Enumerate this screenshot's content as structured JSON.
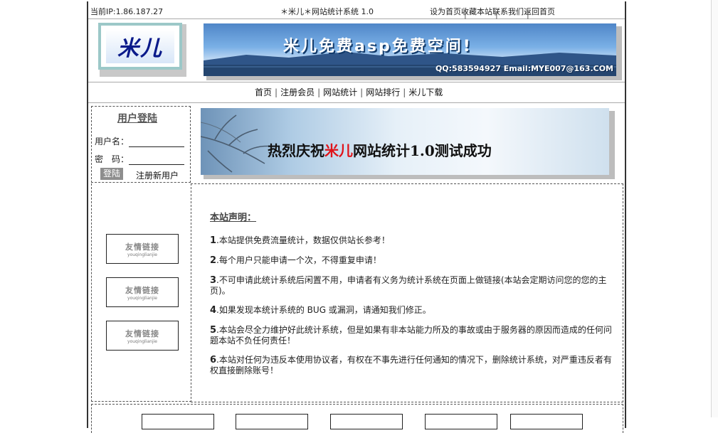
{
  "topbar": {
    "ip": "当前IP:1.86.187.27",
    "site_title": "＊米儿＊网站统计系统 1.0",
    "links": [
      "设为首页",
      "收藏本站",
      "联系我们",
      "返回首页"
    ],
    "separator": "|"
  },
  "logo": {
    "text": "米儿"
  },
  "banner": {
    "title": "米儿免费asp免费空间!",
    "contact": "QQ:583594927 Email:MYE007@163.COM"
  },
  "nav": {
    "items": [
      "首页",
      "注册会员",
      "网站统计",
      "网站排行",
      "米儿下载"
    ],
    "separator": "|"
  },
  "login": {
    "title": "用户登陆",
    "username_label": "用户名：",
    "password_label": "密　码：",
    "submit_label": "登陆",
    "register_label": "注册新用户"
  },
  "ad_banner": {
    "text_before": "热烈庆祝",
    "text_highlight": "米儿",
    "text_after": "网站统计1.0测试成功"
  },
  "links_sidebar": {
    "items": [
      {
        "title": "友情链接",
        "pinyin": "youqinglianjie"
      },
      {
        "title": "友情链接",
        "pinyin": "youqinglianjie"
      },
      {
        "title": "友情链接",
        "pinyin": "youqinglianjie"
      }
    ]
  },
  "notice": {
    "title": "本站声明：",
    "items": [
      {
        "num": "1",
        "text": ".本站提供免费流量统计，数据仅供站长参考！"
      },
      {
        "num": "2",
        "text": ".每个用户只能申请一个次，不得重复申请！"
      },
      {
        "num": "3",
        "text": ".不可申请此统计系统后闲置不用，申请者有义务为统计系统在页面上做链接(本站会定期访问您的您的主页)。"
      },
      {
        "num": "4",
        "text": ".如果发现本统计系统的 BUG 或漏洞，请通知我们修正。"
      },
      {
        "num": "5",
        "text": ".本站会尽全力维护好此统计系统，但是如果有非本站能力所及的事故或由于服务器的原因而造成的任何问题本站不负任何责任！"
      },
      {
        "num": "6",
        "text": ".本站对任何为违反本使用协议者，有权在不事先进行任何通知的情况下，删除统计系统，对严重违反者有权直接删除账号！"
      }
    ]
  },
  "colors": {
    "accent_red": "#e0141a",
    "logo_blue": "#0a1a8a",
    "banner_blue": "#4f86c8"
  }
}
